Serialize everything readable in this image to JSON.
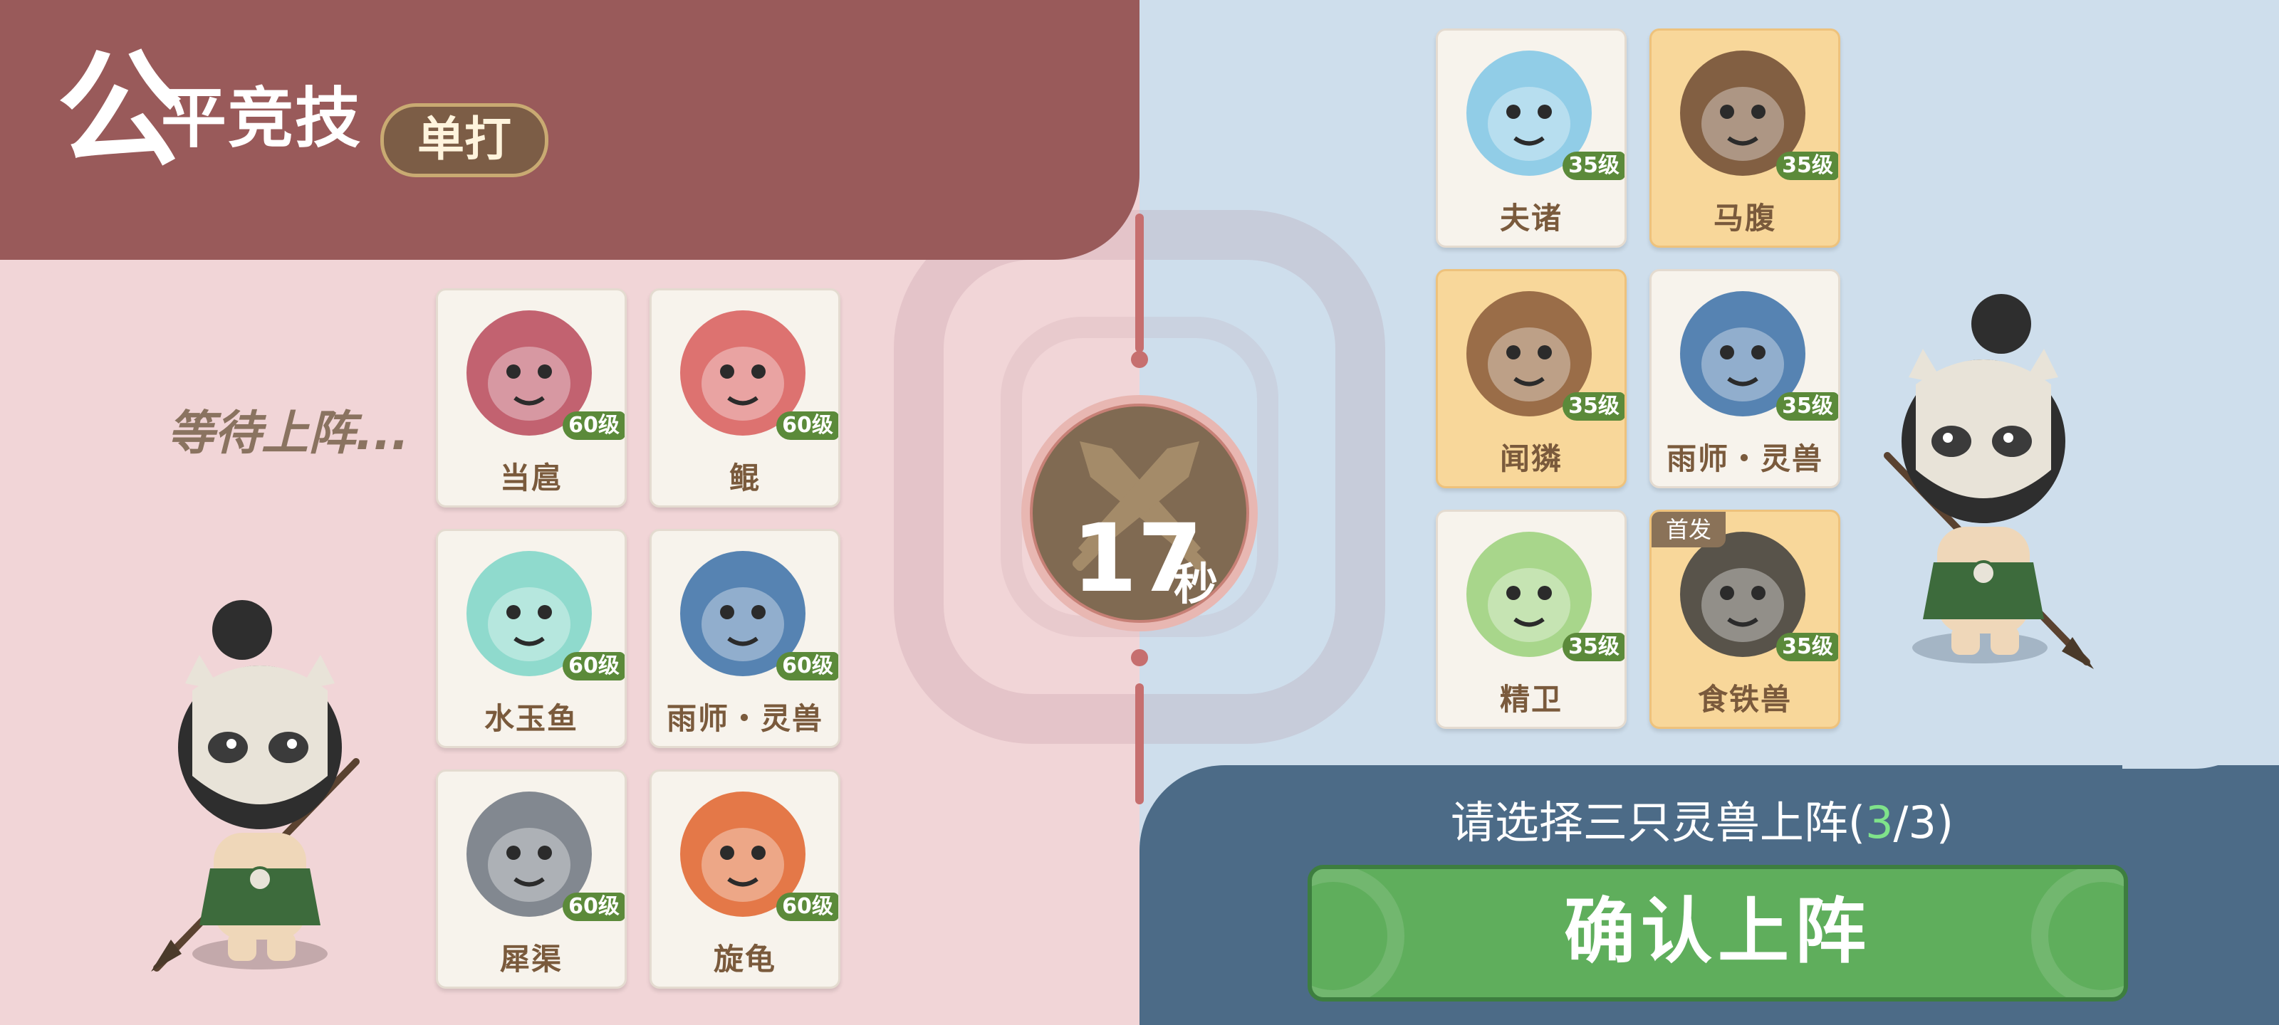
{
  "header": {
    "title_first_char": "公",
    "title_rest": "平竞技",
    "mode_badge": "单打"
  },
  "opponent": {
    "status_text": "等待上阵...",
    "pets": [
      {
        "name": "当扈",
        "level": "60级",
        "color": "#b8485a"
      },
      {
        "name": "鲲",
        "level": "60级",
        "color": "#d85b5b"
      },
      {
        "name": "水玉鱼",
        "level": "60级",
        "color": "#7cd5c8"
      },
      {
        "name": "雨师・灵兽",
        "level": "60级",
        "color": "#3a6fa8"
      },
      {
        "name": "犀渠",
        "level": "60级",
        "color": "#6d7480"
      },
      {
        "name": "旋龟",
        "level": "60级",
        "color": "#e0622c"
      }
    ]
  },
  "timer": {
    "value": "17",
    "unit": "秒"
  },
  "player": {
    "pets": [
      {
        "name": "夫诸",
        "level": "35级",
        "selected": false,
        "color": "#7fc6e6"
      },
      {
        "name": "马腹",
        "level": "35级",
        "selected": true,
        "color": "#6d4a32"
      },
      {
        "name": "闻獜",
        "level": "35级",
        "selected": true,
        "color": "#8a5a3a"
      },
      {
        "name": "雨师・灵兽",
        "level": "35级",
        "selected": false,
        "color": "#3a6fa8"
      },
      {
        "name": "精卫",
        "level": "35级",
        "selected": false,
        "color": "#9ad07a"
      },
      {
        "name": "食铁兽",
        "level": "35级",
        "selected": true,
        "color": "#3c3c3c",
        "tag": "首发"
      }
    ],
    "prompt_prefix": "请选择三只灵兽上阵(",
    "prompt_current": "3",
    "prompt_sep": "/",
    "prompt_total": "3",
    "prompt_suffix": ")",
    "confirm_label": "确认上阵"
  },
  "colors": {
    "left_header": "#995a5a",
    "left_bg": "#f1d5d7",
    "right_bg": "#cedeec",
    "right_footer": "#4c6b87",
    "confirm_green": "#5fae5c",
    "level_badge": "#5b8a3a"
  }
}
